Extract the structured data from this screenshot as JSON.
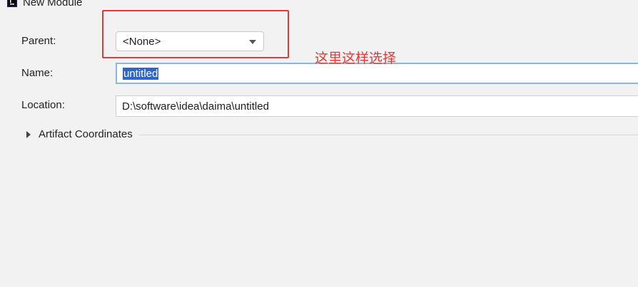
{
  "window": {
    "title": "New Module",
    "icon": "intellij-app-icon"
  },
  "form": {
    "parent": {
      "label": "Parent:",
      "value": "<None>",
      "icon": "chevron-down-icon"
    },
    "name": {
      "label": "Name:",
      "value": "untitled",
      "selected": true
    },
    "location": {
      "label": "Location:",
      "value": "D:\\software\\idea\\daima\\untitled"
    }
  },
  "sections": {
    "artifact_coordinates": {
      "label": "Artifact Coordinates",
      "expanded": false,
      "icon": "expand-triangle-icon"
    }
  },
  "annotation": {
    "text": "这里这样选择",
    "color": "#e53935"
  },
  "colors": {
    "selection": "#2f65ca",
    "focus_border": "#87b7e6",
    "highlight": "#e53935"
  }
}
